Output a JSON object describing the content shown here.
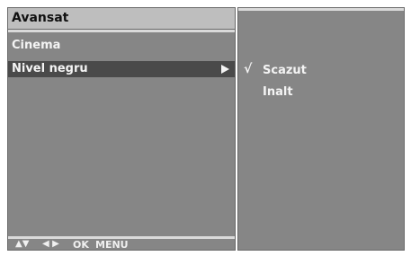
{
  "menu": {
    "title": "Avansat",
    "items": [
      {
        "label": "Cinema"
      },
      {
        "label": "Nivel negru"
      }
    ]
  },
  "submenu": {
    "options": [
      {
        "label": "Scazut",
        "checked": true
      },
      {
        "label": "Inalt",
        "checked": false
      }
    ],
    "check_mark": "√"
  },
  "footer": {
    "updown_icon": "▲▼",
    "leftright_icon": "◀ ▶",
    "ok_label": "OK",
    "menu_label": "MENU"
  },
  "colors": {
    "panel": "#868686",
    "header": "#bebebe",
    "highlight": "#4a4a4a",
    "text": "#f4f4f4"
  }
}
